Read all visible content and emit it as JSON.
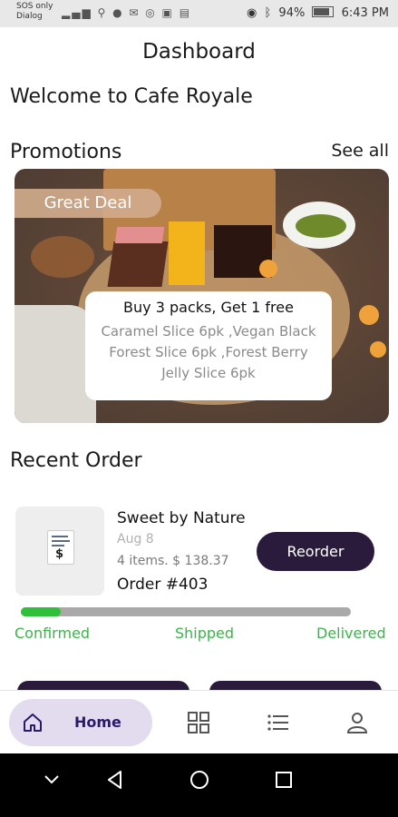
{
  "status_bar": {
    "carrier_line1": "SOS only",
    "carrier_line2": "Dialog",
    "battery": "94%",
    "time": "6:43 PM"
  },
  "header": {
    "title": "Dashboard"
  },
  "welcome": "Welcome to Cafe Royale",
  "promotions": {
    "title": "Promotions",
    "see_all": "See all",
    "badge": "Great Deal",
    "headline": "Buy 3 packs, Get 1 free",
    "description": "Caramel Slice 6pk ,Vegan Black Forest Slice 6pk ,Forest Berry Jelly Slice 6pk"
  },
  "recent_order": {
    "title": "Recent Order",
    "store": "Sweet by Nature",
    "date": "Aug 8",
    "items": "4 items. $ 138.37",
    "order_number": "Order #403",
    "reorder_label": "Reorder",
    "progress": 0.12,
    "stages": [
      "Confirmed",
      "Shipped",
      "Delivered"
    ]
  },
  "bottom_nav": {
    "home_label": "Home",
    "icons": [
      "home-icon",
      "grid-icon",
      "list-icon",
      "profile-icon"
    ]
  },
  "colors": {
    "accent": "#2a1a3b",
    "home_pill": "#e3dcef",
    "progress": "#2fbf3a",
    "stage_text": "#3bb54a"
  }
}
